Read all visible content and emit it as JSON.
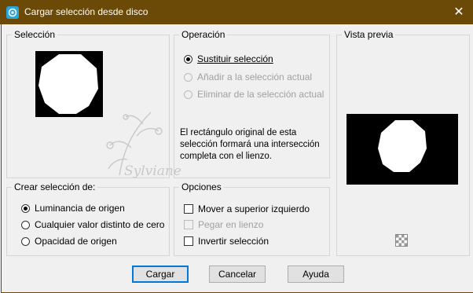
{
  "window": {
    "title": "Cargar selección desde disco",
    "close_glyph": "✕"
  },
  "groups": {
    "selection": "Selección",
    "operation": "Operación",
    "preview": "Vista previa",
    "create_from": "Crear selección de:",
    "options": "Opciones"
  },
  "operation": {
    "replace": {
      "label": "Sustituir selección",
      "checked": true,
      "enabled": true
    },
    "add": {
      "label": "Añadir a la selección actual",
      "checked": false,
      "enabled": false
    },
    "remove": {
      "label": "Eliminar de la selección actual",
      "checked": false,
      "enabled": false
    },
    "description": "El rectángulo original de esta selección formará una intersección completa con el lienzo."
  },
  "create_from": {
    "luminance": {
      "label": "Luminancia de origen",
      "checked": true
    },
    "nonzero": {
      "label": "Cualquier valor distinto de cero",
      "checked": false
    },
    "opacity": {
      "label": "Opacidad de origen",
      "checked": false
    }
  },
  "options": {
    "move_top_left": {
      "label": "Mover a superior izquierdo",
      "checked": false,
      "enabled": true
    },
    "paste_canvas": {
      "label": "Pegar en lienzo",
      "checked": false,
      "enabled": false
    },
    "invert": {
      "label": "Invertir selección",
      "checked": false,
      "enabled": true
    }
  },
  "watermark": "Sylviane",
  "buttons": {
    "load": "Cargar",
    "cancel": "Cancelar",
    "help": "Ayuda"
  },
  "colors": {
    "titlebar": "#6b4a08",
    "accent": "#0078d7"
  }
}
